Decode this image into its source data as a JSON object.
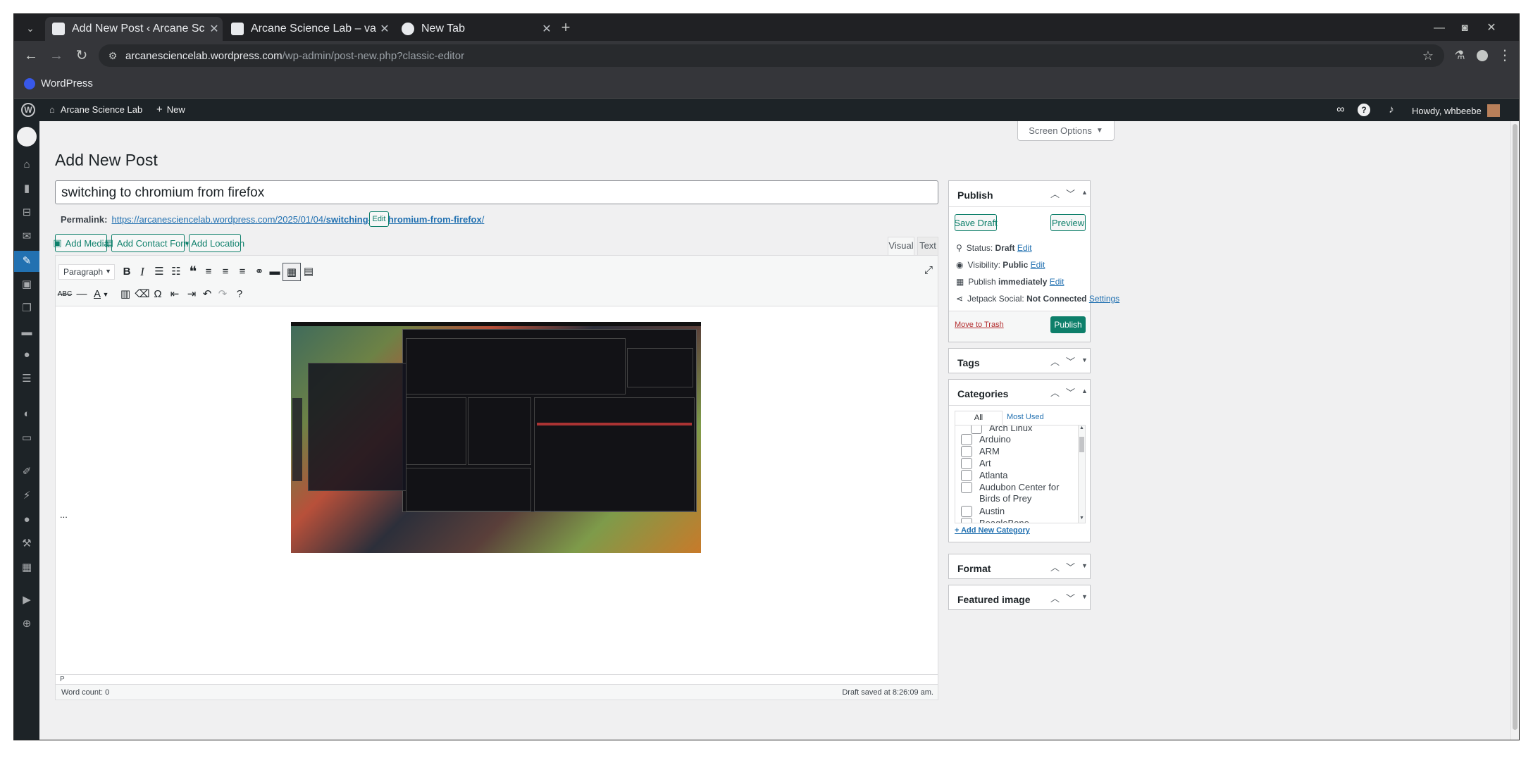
{
  "browser": {
    "tabs": [
      {
        "title": "Add New Post ‹ Arcane Sc"
      },
      {
        "title": "Arcane Science Lab – var"
      },
      {
        "title": "New Tab"
      }
    ],
    "url_domain": "arcanesciencelab.wordpress.com",
    "url_path": "/wp-admin/post-new.php?classic-editor",
    "bookmark_wordpress": "WordPress"
  },
  "adminbar": {
    "site_name": "Arcane Science Lab",
    "new_label": "New",
    "howdy": "Howdy, whbeebe"
  },
  "page": {
    "title": "Add New Post",
    "screen_options": "Screen Options",
    "post_title": "switching to chromium from firefox",
    "permalink_label": "Permalink:",
    "permalink_base": "https://arcanesciencelab.wordpress.com/2025/01/04/",
    "permalink_slug": "switching-to-chromium-from-firefox",
    "permalink_suffix": "/",
    "permalink_edit": "Edit"
  },
  "editor": {
    "add_media": "Add Media",
    "add_contact_form": "Add Contact Form",
    "add_location": "Add Location",
    "tab_visual": "Visual",
    "tab_text": "Text",
    "format_select": "Paragraph",
    "body_ellipsis": "...",
    "path": "P",
    "word_count": "Word count: 0",
    "draft_saved": "Draft saved at 8:26:09 am."
  },
  "publish": {
    "title": "Publish",
    "save_draft": "Save Draft",
    "preview": "Preview",
    "status_label": "Status:",
    "status_value": "Draft",
    "visibility_label": "Visibility:",
    "visibility_value": "Public",
    "publish_label": "Publish",
    "publish_value": "immediately",
    "edit": "Edit",
    "jetpack_label": "Jetpack Social:",
    "jetpack_value": "Not Connected",
    "jetpack_settings": "Settings",
    "move_to_trash": "Move to Trash",
    "publish_button": "Publish"
  },
  "tags": {
    "title": "Tags"
  },
  "categories": {
    "title": "Categories",
    "tab_all": "All Categories",
    "tab_most_used": "Most Used",
    "items": [
      "Arch Linux",
      "Arduino",
      "ARM",
      "Art",
      "Atlanta",
      "Audubon Center for Birds of Prey",
      "Austin",
      "BeagleBone"
    ],
    "add_new": "+ Add New Category"
  },
  "format": {
    "title": "Format"
  },
  "featured_image": {
    "title": "Featured image"
  },
  "colors": {
    "adminbar": "#1d2327",
    "accent": "#2271b1",
    "publish_green": "#0d7f6a",
    "chrome_dark": "#202124"
  }
}
